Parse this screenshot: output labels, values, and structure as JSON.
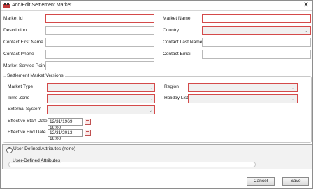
{
  "window": {
    "title": "Add/Edit Settlement Market"
  },
  "fields": {
    "market_id_label": "Market Id",
    "market_name_label": "Market Name",
    "description_label": "Description",
    "country_label": "Country",
    "contact_first_name_label": "Contact First Name",
    "contact_last_name_label": "Contact Last Name",
    "contact_phone_label": "Contact Phone",
    "contact_email_label": "Contact Email",
    "market_service_point_label": "Market Service Point"
  },
  "versions": {
    "legend": "Settlement Market Versions",
    "market_type_label": "Market Type",
    "region_label": "Region",
    "time_zone_label": "Time Zone",
    "holiday_list_label": "Holiday List",
    "external_system_label": "External System",
    "effective_start_label": "Effective Start Date",
    "effective_start_value": "12/31/1969 19:00",
    "effective_end_label": "Effective End Date",
    "effective_end_value": "12/31/2013 19:00"
  },
  "uda": {
    "header": "User-Defined Attributes (none)",
    "legend": "User-Defined Attributes"
  },
  "buttons": {
    "cancel": "Cancel",
    "save": "Save"
  },
  "colors": {
    "required_border": "#d44a4a"
  }
}
